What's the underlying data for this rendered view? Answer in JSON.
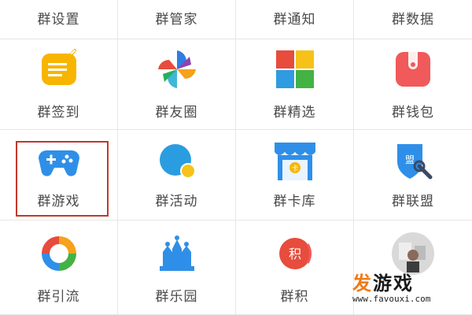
{
  "grid": {
    "rows": [
      [
        "群设置",
        "群管家",
        "群通知",
        "群数据"
      ],
      [
        "群签到",
        "群友圈",
        "群精选",
        "群钱包"
      ],
      [
        "群游戏",
        "群活动",
        "群卡库",
        "群联盟"
      ],
      [
        "群引流",
        "群乐园",
        "群积",
        ""
      ]
    ]
  },
  "icons": {
    "群签到": "sign-in-note-icon",
    "群友圈": "pinwheel-icon",
    "群精选": "four-color-tiles-icon",
    "群钱包": "wallet-icon",
    "群游戏": "gamepad-icon",
    "群活动": "activity-bubble-icon",
    "群卡库": "card-store-icon",
    "群联盟": "alliance-shield-icon",
    "群引流": "color-ring-icon",
    "群乐园": "crown-park-icon",
    "群积": "points-badge-icon",
    "avatar": "user-avatar-icon"
  },
  "highlighted": "群游戏",
  "watermark": {
    "char_accent": "发",
    "text_rest": "游戏",
    "url": "www.favouxi.com"
  },
  "colors": {
    "highlight_border": "#c0392b",
    "label_text": "#4a4a4a",
    "grid_line": "#e6e6e6",
    "watermark_accent": "#f07a16"
  }
}
